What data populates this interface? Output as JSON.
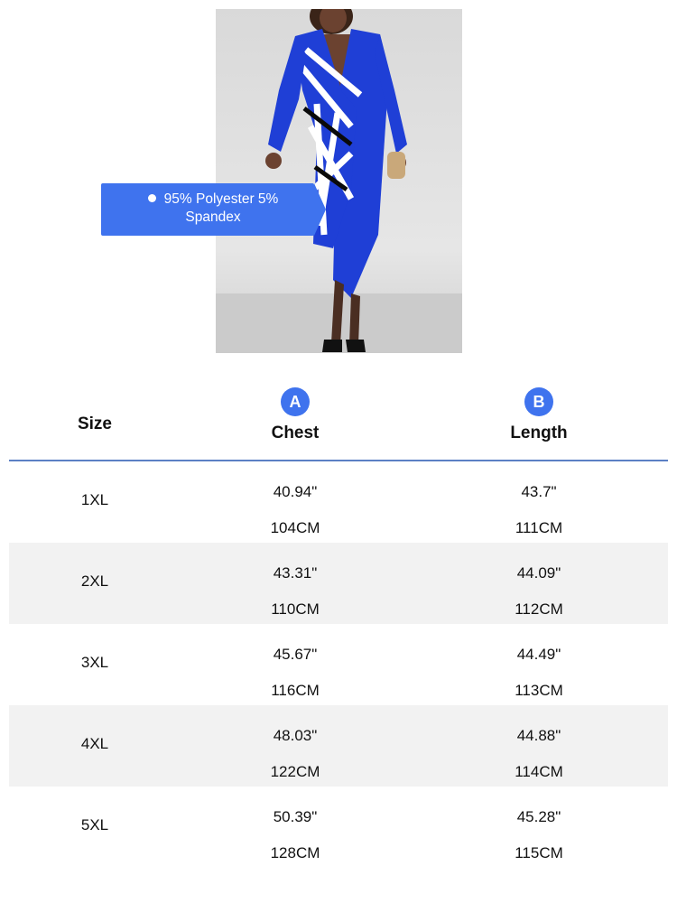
{
  "product": {
    "callout": "95% Polyester 5% Spandex",
    "colors": {
      "accent": "#3f73ee",
      "dress": "#1f3fd6",
      "divider": "#5b80c4"
    }
  },
  "table": {
    "headers": {
      "size": "Size",
      "chest_badge": "A",
      "chest": "Chest",
      "length_badge": "B",
      "length": "Length"
    },
    "rows": [
      {
        "size": "1XL",
        "chest_in": "40.94\"",
        "chest_cm": "104CM",
        "length_in": "43.7\"",
        "length_cm": "111CM"
      },
      {
        "size": "2XL",
        "chest_in": "43.31\"",
        "chest_cm": "110CM",
        "length_in": "44.09\"",
        "length_cm": "112CM"
      },
      {
        "size": "3XL",
        "chest_in": "45.67\"",
        "chest_cm": "116CM",
        "length_in": "44.49\"",
        "length_cm": "113CM"
      },
      {
        "size": "4XL",
        "chest_in": "48.03\"",
        "chest_cm": "122CM",
        "length_in": "44.88\"",
        "length_cm": "114CM"
      },
      {
        "size": "5XL",
        "chest_in": "50.39\"",
        "chest_cm": "128CM",
        "length_in": "45.28\"",
        "length_cm": "115CM"
      }
    ]
  }
}
